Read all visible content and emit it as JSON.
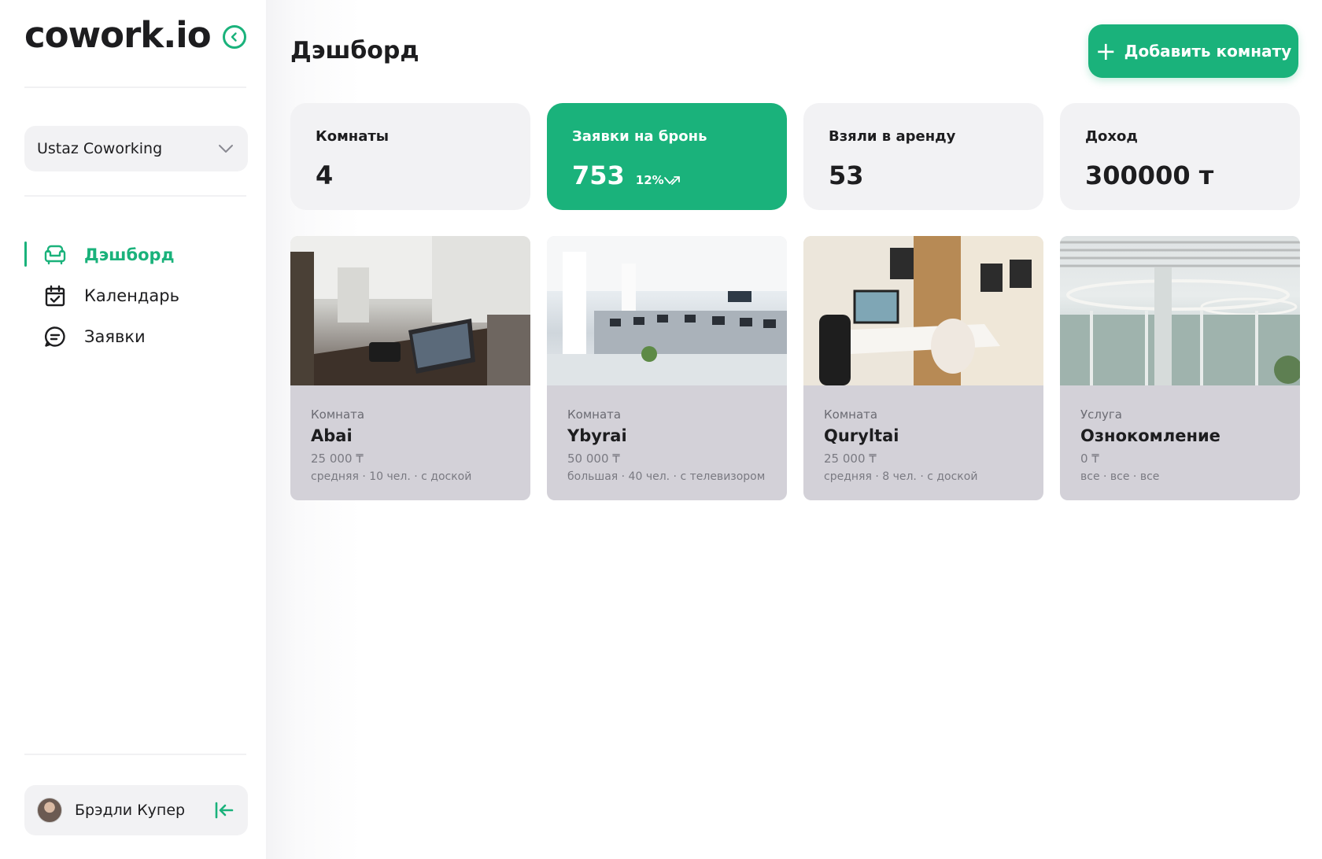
{
  "app": {
    "logo": "cowork.io",
    "accent_color": "#1ab27b"
  },
  "sidebar": {
    "workspace": "Ustaz Coworking",
    "nav": [
      {
        "label": "Дэшборд",
        "icon": "armchair-icon",
        "active": true
      },
      {
        "label": "Календарь",
        "icon": "calendar-check-icon",
        "active": false
      },
      {
        "label": "Заявки",
        "icon": "message-icon",
        "active": false
      }
    ],
    "user": {
      "name": "Брэдли Купер"
    }
  },
  "header": {
    "title": "Дэшборд",
    "add_button": "Добавить комнату"
  },
  "stats": [
    {
      "label": "Комнаты",
      "value": "4"
    },
    {
      "label": "Заявки на бронь",
      "value": "753",
      "change": "12%"
    },
    {
      "label": "Взяли в аренду",
      "value": "53"
    },
    {
      "label": "Доход",
      "value": "300000 т"
    }
  ],
  "rooms": [
    {
      "type": "Комната",
      "name": "Abai",
      "price": "25 000 ₸",
      "details": "средняя · 10 чел. · с доской"
    },
    {
      "type": "Комната",
      "name": "Ybyrai",
      "price": "50 000 ₸",
      "details": "большая · 40 чел. · с телевизором"
    },
    {
      "type": "Комната",
      "name": "Quryltai",
      "price": "25 000 ₸",
      "details": "средняя · 8 чел. · с доской"
    },
    {
      "type": "Услуга",
      "name": "Ознокомление",
      "price": "0 ₸",
      "details": "все · все · все"
    }
  ]
}
